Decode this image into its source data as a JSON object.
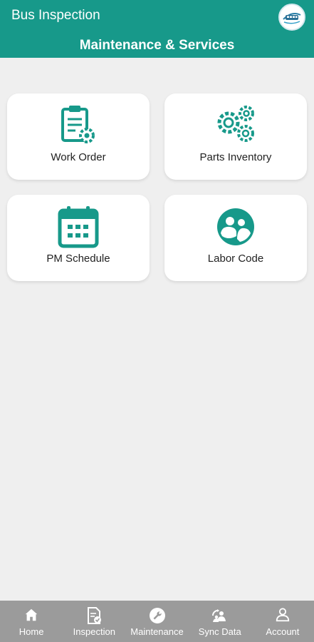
{
  "header": {
    "app_title": "Bus Inspection",
    "page_title": "Maintenance & Services",
    "background_color": "#17998a"
  },
  "tiles": [
    {
      "label": "Work Order",
      "icon": "clipboard-gear-icon"
    },
    {
      "label": "Parts Inventory",
      "icon": "gears-icon"
    },
    {
      "label": "PM Schedule",
      "icon": "calendar-icon"
    },
    {
      "label": "Labor Code",
      "icon": "people-circle-icon"
    }
  ],
  "accent_color": "#17998a",
  "bottom_nav": {
    "background_color": "#9b9b9b",
    "items": [
      {
        "label": "Home",
        "icon": "home-icon"
      },
      {
        "label": "Inspection",
        "icon": "document-check-icon"
      },
      {
        "label": "Maintenance",
        "icon": "wrench-icon"
      },
      {
        "label": "Sync Data",
        "icon": "sync-users-icon"
      },
      {
        "label": "Account",
        "icon": "person-icon"
      }
    ]
  }
}
